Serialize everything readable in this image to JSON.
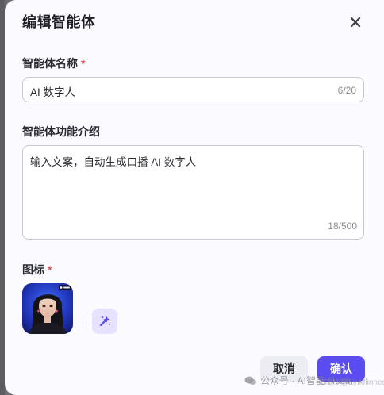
{
  "dialog": {
    "title": "编辑智能体",
    "close_icon": "close-icon"
  },
  "name_field": {
    "label": "智能体名称",
    "required_mark": "*",
    "value": "AI 数字人",
    "counter": "6/20"
  },
  "intro_field": {
    "label": "智能体功能介绍",
    "value": "输入文案，自动生成口播 AI 数字人",
    "counter": "18/500"
  },
  "icon_field": {
    "label": "图标",
    "required_mark": "*",
    "avatar_icon": "avatar-image",
    "generate_icon": "sparkle-magic-icon"
  },
  "footer": {
    "cancel_label": "取消",
    "confirm_label": "确认"
  },
  "watermark": {
    "text": "公众号 · AI智能 Robin",
    "secondary": "CSDN @Linkflinnes"
  },
  "colors": {
    "accent": "#5a4cf0",
    "required": "#e5484d",
    "magic_button_bg": "#e6e2ff"
  }
}
